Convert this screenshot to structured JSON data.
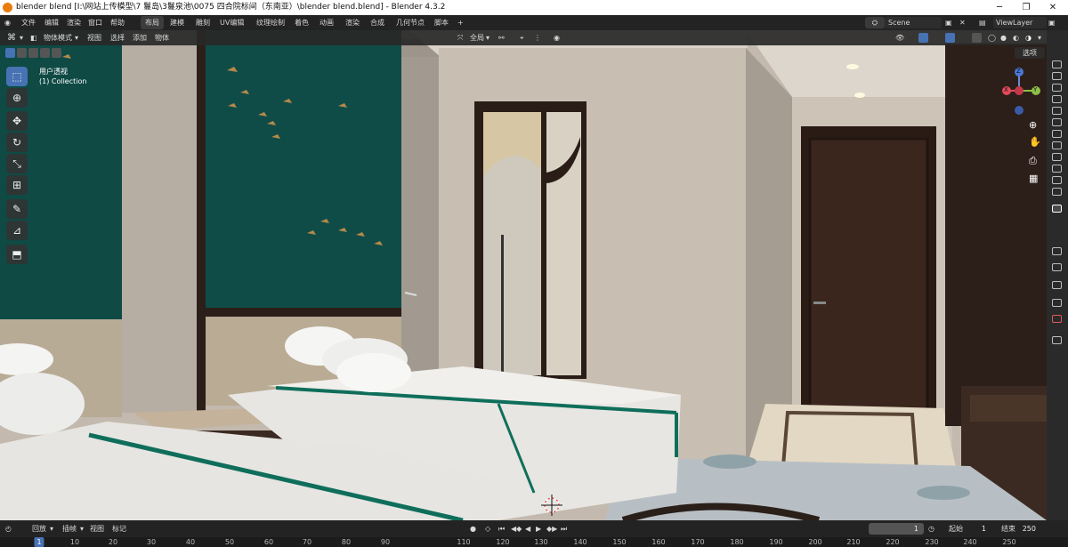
{
  "window": {
    "title": "blender  blend [I:\\网站上传模型\\7 鬘岛\\3鬘泉池\\0075 四合院标间（东南亚）\\blender  blend.blend] - Blender 4.3.2",
    "controls": [
      "─",
      "❐",
      "✕"
    ]
  },
  "menu": {
    "items": [
      "文件",
      "编辑",
      "渲染",
      "窗口",
      "帮助"
    ],
    "workspaces": [
      "布局",
      "建模",
      "雕刻",
      "UV编辑",
      "纹理绘制",
      "着色",
      "动画",
      "渲染",
      "合成",
      "几何节点",
      "脚本",
      "+"
    ],
    "active_workspace": "布局",
    "scene": "Scene",
    "view_layer": "ViewLayer"
  },
  "viewport_header": {
    "mode": "物体模式",
    "menus": [
      "视图",
      "选择",
      "添加",
      "物体"
    ],
    "orientation": "全局",
    "options": "选项"
  },
  "viewport": {
    "view_name": "用户透视",
    "collection": "(1) Collection"
  },
  "gizmo": {
    "x": "X",
    "y": "Y",
    "z": "Z"
  },
  "timeline": {
    "menus": [
      "回放",
      "插帧",
      "视图",
      "标记"
    ],
    "current_frame": "1",
    "start_label": "起始",
    "start": "1",
    "end_label": "结束",
    "end": "250",
    "ruler": [
      "1",
      "10",
      "20",
      "30",
      "40",
      "50",
      "60",
      "70",
      "80",
      "90",
      "110",
      "120",
      "130",
      "140",
      "150",
      "160",
      "170",
      "180",
      "190",
      "200",
      "210",
      "220",
      "230",
      "240",
      "250"
    ]
  },
  "tools": [
    "select-box-tool",
    "cursor-tool",
    "move-tool",
    "rotate-tool",
    "scale-tool",
    "transform-tool",
    "annotate-tool",
    "measure-tool",
    "add-cube-tool"
  ],
  "colors": {
    "accent": "#4772b3",
    "wall": "#c6bcb0",
    "teal_panel": "#0f4a45",
    "door": "#2a1b15",
    "bedding": "#e9e9e6",
    "stripe": "#0f6e5b"
  }
}
